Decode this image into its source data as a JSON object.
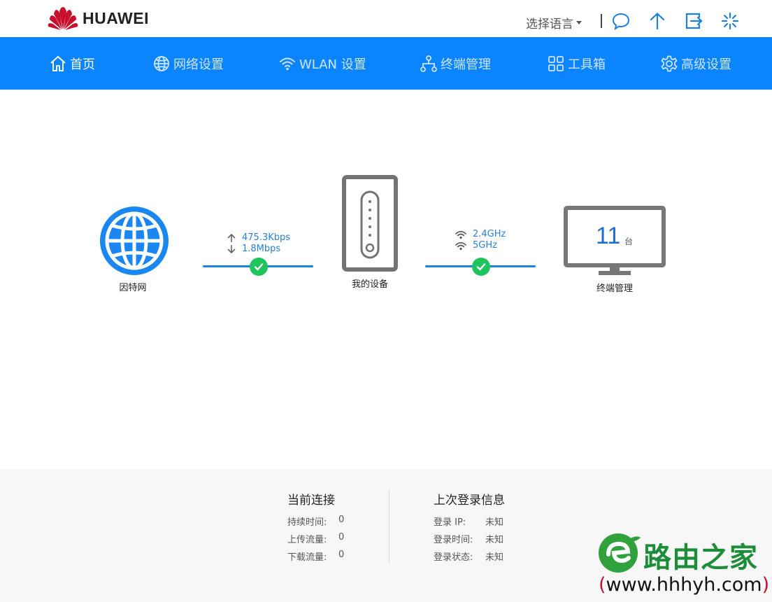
{
  "header": {
    "brand": "HUAWEI",
    "language_label": "选择语言",
    "icons": [
      "chat-icon",
      "upload-icon",
      "logout-icon",
      "loading-icon"
    ]
  },
  "nav": {
    "items": [
      {
        "label": "首页",
        "icon": "home-icon",
        "active": true
      },
      {
        "label": "网络设置",
        "icon": "globe-icon",
        "active": false
      },
      {
        "label": "WLAN 设置",
        "icon": "wifi-icon",
        "active": false
      },
      {
        "label": "终端管理",
        "icon": "network-tree-icon",
        "active": false
      },
      {
        "label": "工具箱",
        "icon": "grid-icon",
        "active": false
      },
      {
        "label": "高级设置",
        "icon": "gear-icon",
        "active": false
      }
    ]
  },
  "topology": {
    "internet_label": "因特网",
    "upload_rate": "475.3Kbps",
    "download_rate": "1.8Mbps",
    "device_label": "我的设备",
    "band_24": "2.4GHz",
    "band_5": "5GHz",
    "terminal_count": "11",
    "terminal_unit": "台",
    "terminal_label": "终端管理"
  },
  "footer": {
    "current": {
      "title": "当前连接",
      "rows": [
        {
          "key": "持续时间:",
          "value": "0"
        },
        {
          "key": "上传流量:",
          "value": "0"
        },
        {
          "key": "下载流量:",
          "value": "0"
        }
      ]
    },
    "last_login": {
      "title": "上次登录信息",
      "rows": [
        {
          "key": "登录 IP:",
          "value": "未知"
        },
        {
          "key": "登录时间:",
          "value": "未知"
        },
        {
          "key": "登录状态:",
          "value": "未知"
        }
      ]
    }
  },
  "watermark": {
    "brand": "路由之家",
    "url_open": "(",
    "url": "www.hhhyh.com",
    "url_close": ")"
  },
  "colors": {
    "nav_bg": "#0a84ff",
    "accent": "#1d7fe0",
    "ok": "#1fc45e",
    "brand_red": "#c8102e"
  }
}
